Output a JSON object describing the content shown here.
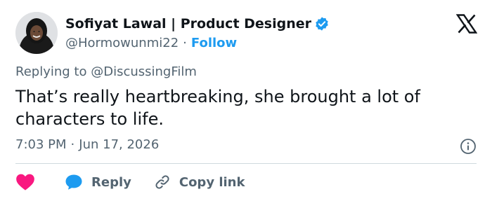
{
  "author": {
    "display_name": "Sofiyat Lawal | Product Designer",
    "handle": "@Hormowunmi22",
    "separator": "·",
    "follow_label": "Follow",
    "verified": true
  },
  "tweet": {
    "replying_prefix": "Replying to",
    "replying_to": "@DiscussingFilm",
    "text": "That’s really heartbreaking, she brought a lot of characters to life.",
    "time": "7:03 PM",
    "date_separator": "·",
    "date": "Jun 17, 2026"
  },
  "actions": {
    "reply_label": "Reply",
    "copy_label": "Copy link"
  },
  "icons": {
    "logo": "x-logo-icon",
    "verified": "verified-badge-icon",
    "info": "info-icon",
    "like": "heart-icon",
    "reply": "speech-bubble-icon",
    "copy": "link-icon"
  },
  "colors": {
    "accent": "#1d9bf0",
    "like": "#f91880",
    "text": "#0f1419",
    "muted": "#536471",
    "divider": "#cfd9de"
  }
}
